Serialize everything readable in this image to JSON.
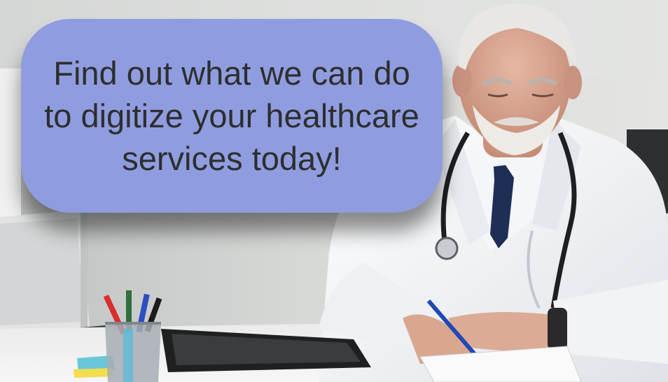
{
  "headline": "Find out what we can do to digitize your healthcare services today!",
  "image": {
    "subject": "doctor-writing-at-desk-photo"
  },
  "colors": {
    "bubble_fill": "#8f9de0",
    "text": "#2e2e2e"
  }
}
